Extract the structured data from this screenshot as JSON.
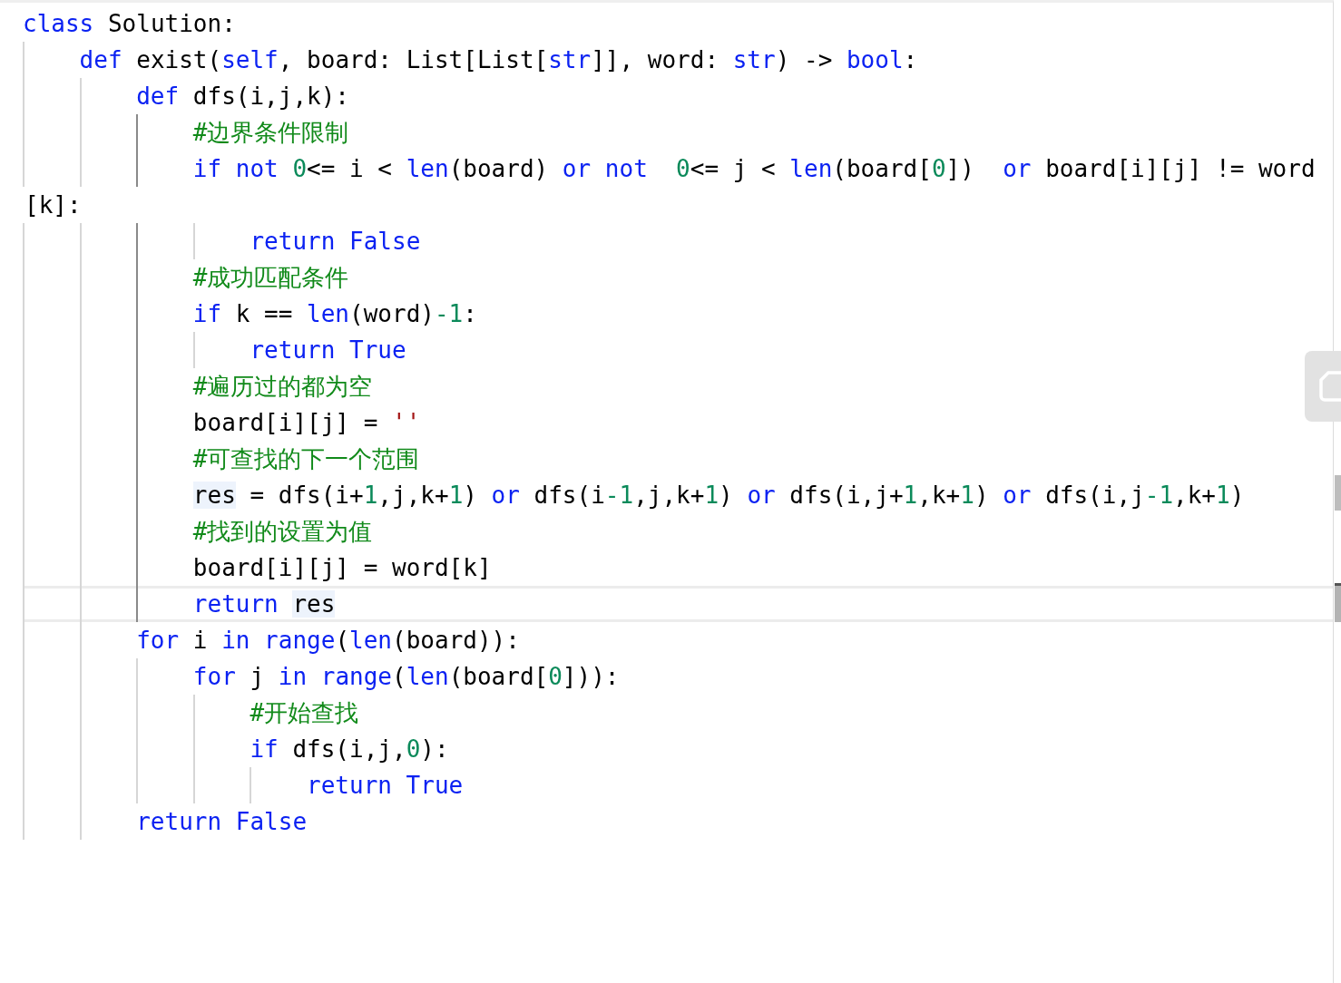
{
  "editor": {
    "lines": [
      {
        "tokens": [
          {
            "kind": "keyword",
            "text": "class"
          },
          {
            "kind": "plain",
            "text": " Solution:"
          }
        ],
        "children": [
          {
            "tokens": [
              {
                "kind": "keyword",
                "text": "def"
              },
              {
                "kind": "plain",
                "text": " exist("
              },
              {
                "kind": "keyword",
                "text": "self"
              },
              {
                "kind": "plain",
                "text": ", board: List[List["
              },
              {
                "kind": "keyword",
                "text": "str"
              },
              {
                "kind": "plain",
                "text": "]], word: "
              },
              {
                "kind": "keyword",
                "text": "str"
              },
              {
                "kind": "plain",
                "text": ") -> "
              },
              {
                "kind": "keyword",
                "text": "bool"
              },
              {
                "kind": "plain",
                "text": ":"
              }
            ],
            "children": [
              {
                "active": true,
                "tokens": [
                  {
                    "kind": "keyword",
                    "text": "def"
                  },
                  {
                    "kind": "plain",
                    "text": " dfs(i,j,k):"
                  }
                ],
                "children": [
                  {
                    "tokens": [
                      {
                        "kind": "comment",
                        "text": "#边界条件限制"
                      }
                    ]
                  },
                  {
                    "tokens": [
                      {
                        "kind": "keyword",
                        "text": "if"
                      },
                      {
                        "kind": "keyword",
                        "text": " not"
                      },
                      {
                        "kind": "number",
                        "text": " 0"
                      },
                      {
                        "kind": "plain",
                        "text": "<= i < "
                      },
                      {
                        "kind": "keyword",
                        "text": "len"
                      },
                      {
                        "kind": "plain",
                        "text": "(board) "
                      },
                      {
                        "kind": "keyword",
                        "text": "or"
                      },
                      {
                        "kind": "keyword",
                        "text": " not"
                      },
                      {
                        "kind": "number",
                        "text": "  0"
                      },
                      {
                        "kind": "plain",
                        "text": "<= j < "
                      },
                      {
                        "kind": "keyword",
                        "text": "len"
                      },
                      {
                        "kind": "plain",
                        "text": "(board["
                      },
                      {
                        "kind": "number",
                        "text": "0"
                      },
                      {
                        "kind": "plain",
                        "text": "])  "
                      },
                      {
                        "kind": "keyword",
                        "text": "or"
                      },
                      {
                        "kind": "plain",
                        "text": " board[i][j] != word"
                      }
                    ],
                    "continuation": [
                      {
                        "kind": "plain",
                        "text": "[k]:"
                      }
                    ],
                    "children": [
                      {
                        "tokens": [
                          {
                            "kind": "keyword",
                            "text": "return"
                          },
                          {
                            "kind": "keyword",
                            "text": " False"
                          }
                        ]
                      }
                    ]
                  },
                  {
                    "tokens": [
                      {
                        "kind": "comment",
                        "text": "#成功匹配条件"
                      }
                    ]
                  },
                  {
                    "tokens": [
                      {
                        "kind": "keyword",
                        "text": "if"
                      },
                      {
                        "kind": "plain",
                        "text": " k == "
                      },
                      {
                        "kind": "keyword",
                        "text": "len"
                      },
                      {
                        "kind": "plain",
                        "text": "(word)"
                      },
                      {
                        "kind": "number",
                        "text": "-1"
                      },
                      {
                        "kind": "plain",
                        "text": ":"
                      }
                    ],
                    "children": [
                      {
                        "tokens": [
                          {
                            "kind": "keyword",
                            "text": "return"
                          },
                          {
                            "kind": "keyword",
                            "text": " True"
                          }
                        ]
                      }
                    ]
                  },
                  {
                    "tokens": [
                      {
                        "kind": "comment",
                        "text": "#遍历过的都为空"
                      }
                    ]
                  },
                  {
                    "tokens": [
                      {
                        "kind": "plain",
                        "text": "board[i][j] = "
                      },
                      {
                        "kind": "string",
                        "text": "''"
                      }
                    ]
                  },
                  {
                    "tokens": [
                      {
                        "kind": "comment",
                        "text": "#可查找的下一个范围"
                      }
                    ]
                  },
                  {
                    "tokens": [
                      {
                        "kind": "plain",
                        "text": "res",
                        "highlighted": true
                      },
                      {
                        "kind": "plain",
                        "text": " = dfs(i+"
                      },
                      {
                        "kind": "number",
                        "text": "1"
                      },
                      {
                        "kind": "plain",
                        "text": ",j,k+"
                      },
                      {
                        "kind": "number",
                        "text": "1"
                      },
                      {
                        "kind": "plain",
                        "text": ") "
                      },
                      {
                        "kind": "keyword",
                        "text": "or"
                      },
                      {
                        "kind": "plain",
                        "text": " dfs(i"
                      },
                      {
                        "kind": "number",
                        "text": "-1"
                      },
                      {
                        "kind": "plain",
                        "text": ",j,k+"
                      },
                      {
                        "kind": "number",
                        "text": "1"
                      },
                      {
                        "kind": "plain",
                        "text": ") "
                      },
                      {
                        "kind": "keyword",
                        "text": "or"
                      },
                      {
                        "kind": "plain",
                        "text": " dfs(i,j+"
                      },
                      {
                        "kind": "number",
                        "text": "1"
                      },
                      {
                        "kind": "plain",
                        "text": ",k+"
                      },
                      {
                        "kind": "number",
                        "text": "1"
                      },
                      {
                        "kind": "plain",
                        "text": ") "
                      },
                      {
                        "kind": "keyword",
                        "text": "or"
                      },
                      {
                        "kind": "plain",
                        "text": " dfs(i,j"
                      },
                      {
                        "kind": "number",
                        "text": "-1"
                      },
                      {
                        "kind": "plain",
                        "text": ",k+"
                      },
                      {
                        "kind": "number",
                        "text": "1"
                      },
                      {
                        "kind": "plain",
                        "text": ")"
                      }
                    ]
                  },
                  {
                    "tokens": [
                      {
                        "kind": "comment",
                        "text": "#找到的设置为值"
                      }
                    ]
                  },
                  {
                    "tokens": [
                      {
                        "kind": "plain",
                        "text": "board[i][j] = word[k]"
                      }
                    ]
                  },
                  {
                    "current": true,
                    "tokens": [
                      {
                        "kind": "keyword",
                        "text": "return "
                      },
                      {
                        "kind": "plain",
                        "text": "res",
                        "highlighted": true
                      }
                    ]
                  }
                ]
              },
              {
                "tokens": [
                  {
                    "kind": "keyword",
                    "text": "for"
                  },
                  {
                    "kind": "plain",
                    "text": " i "
                  },
                  {
                    "kind": "keyword",
                    "text": "in"
                  },
                  {
                    "kind": "keyword",
                    "text": " range"
                  },
                  {
                    "kind": "plain",
                    "text": "("
                  },
                  {
                    "kind": "keyword",
                    "text": "len"
                  },
                  {
                    "kind": "plain",
                    "text": "(board)):"
                  }
                ],
                "children": [
                  {
                    "tokens": [
                      {
                        "kind": "keyword",
                        "text": "for"
                      },
                      {
                        "kind": "plain",
                        "text": " j "
                      },
                      {
                        "kind": "keyword",
                        "text": "in"
                      },
                      {
                        "kind": "keyword",
                        "text": " range"
                      },
                      {
                        "kind": "plain",
                        "text": "("
                      },
                      {
                        "kind": "keyword",
                        "text": "len"
                      },
                      {
                        "kind": "plain",
                        "text": "(board["
                      },
                      {
                        "kind": "number",
                        "text": "0"
                      },
                      {
                        "kind": "plain",
                        "text": "])):"
                      }
                    ],
                    "children": [
                      {
                        "tokens": [
                          {
                            "kind": "comment",
                            "text": "#开始查找"
                          }
                        ]
                      },
                      {
                        "tokens": [
                          {
                            "kind": "keyword",
                            "text": "if"
                          },
                          {
                            "kind": "plain",
                            "text": " dfs(i,j,"
                          },
                          {
                            "kind": "number",
                            "text": "0"
                          },
                          {
                            "kind": "plain",
                            "text": "):"
                          }
                        ],
                        "children": [
                          {
                            "tokens": [
                              {
                                "kind": "keyword",
                                "text": "return"
                              },
                              {
                                "kind": "keyword",
                                "text": " True"
                              }
                            ]
                          }
                        ]
                      }
                    ]
                  }
                ]
              },
              {
                "tokens": [
                  {
                    "kind": "keyword",
                    "text": "return"
                  },
                  {
                    "kind": "keyword",
                    "text": " False"
                  }
                ]
              }
            ]
          }
        ]
      }
    ]
  }
}
